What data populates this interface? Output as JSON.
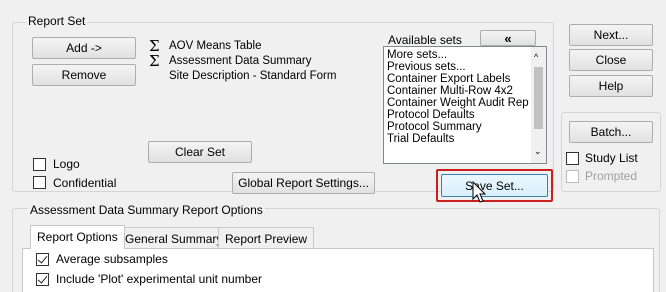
{
  "report_set": {
    "title": "Report Set",
    "add_label": "Add ->",
    "remove_label": "Remove",
    "items": [
      {
        "icon": "sigma-icon",
        "label": "AOV Means Table"
      },
      {
        "icon": "sigma-icon",
        "label": "Assessment Data Summary"
      },
      {
        "icon": "",
        "label": "Site Description - Standard Form"
      }
    ],
    "clear_set_label": "Clear Set",
    "logo_label": "Logo",
    "confidential_label": "Confidential",
    "global_settings_label": "Global Report Settings...",
    "available_sets_label": "Available sets",
    "collapse_label": "«",
    "available_sets": [
      "More sets...",
      "Previous sets...",
      "Container Export Labels",
      "Container Multi-Row 4x2",
      "Container Weight Audit Rep",
      "Protocol Defaults",
      "Protocol Summary",
      "Trial Defaults"
    ],
    "save_set_label": "Save Set..."
  },
  "side": {
    "next_label": "Next...",
    "close_label": "Close",
    "help_label": "Help",
    "batch_label": "Batch...",
    "study_list_label": "Study List",
    "prompted_label": "Prompted"
  },
  "options": {
    "title": "Assessment Data Summary Report Options",
    "tabs": [
      "Report Options",
      "General Summary",
      "Report Preview"
    ],
    "average_subsamples_label": "Average subsamples",
    "include_plot_label": "Include 'Plot' experimental unit number"
  },
  "colors": {
    "highlight": "#c8201e",
    "window_bg": "#f0f0f0"
  }
}
